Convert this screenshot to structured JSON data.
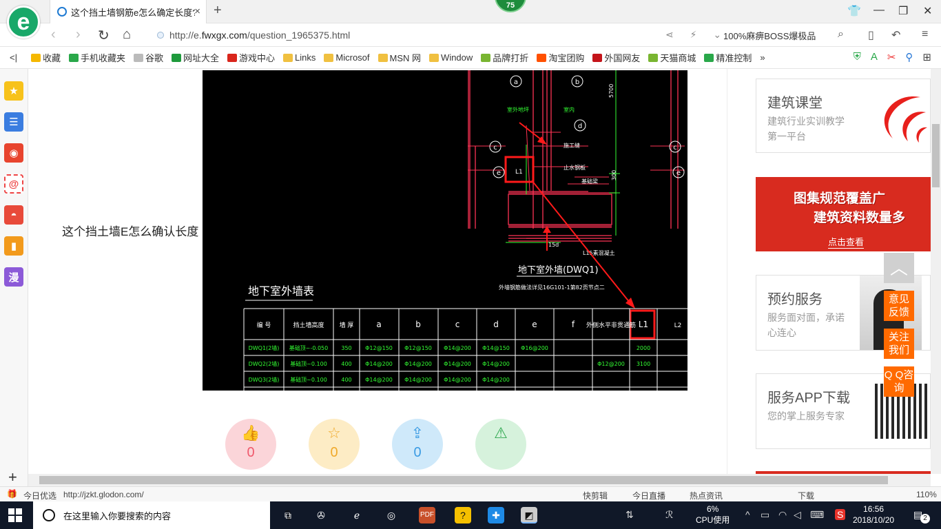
{
  "browser": {
    "tab_title": "这个挡土墙钢筋e怎么确定长度?",
    "tab_close": "×",
    "new_tab": "+",
    "badge_count": "75",
    "url_prefix": "http://e.",
    "url_domain": "fwxgx.com",
    "url_path": "/question_1965375.html",
    "search_label": "100%麻痹BOSS爆极品",
    "bookmarks": [
      {
        "label": "收藏",
        "color": "#f5b800"
      },
      {
        "label": "手机收藏夹",
        "color": "#2aa84a"
      },
      {
        "label": "谷歌",
        "color": "#bbbbbb"
      },
      {
        "label": "网址大全",
        "color": "#1e9a3c"
      },
      {
        "label": "游戏中心",
        "color": "#d9261c"
      },
      {
        "label": "Links",
        "color": "#f0c040"
      },
      {
        "label": "Microsof",
        "color": "#f0c040"
      },
      {
        "label": "MSN 网",
        "color": "#f0c040"
      },
      {
        "label": "Window",
        "color": "#f0c040"
      },
      {
        "label": "品牌打折",
        "color": "#79b531"
      },
      {
        "label": "淘宝团购",
        "color": "#ff5000"
      },
      {
        "label": "外国网友",
        "color": "#c4141a"
      },
      {
        "label": "天猫商城",
        "color": "#79b531"
      },
      {
        "label": "精准控制",
        "color": "#2aa84a"
      }
    ],
    "bookmarks_more": "»"
  },
  "page": {
    "question": "这个挡土墙E怎么确认长度",
    "actions": [
      {
        "name": "like",
        "glyph": "👍",
        "count": "0",
        "bg": "#fbd5d9",
        "fg": "#f0596c"
      },
      {
        "name": "favorite",
        "glyph": "☆",
        "count": "0",
        "bg": "#fdecc5",
        "fg": "#f0a92a"
      },
      {
        "name": "share",
        "glyph": "⇪",
        "count": "0",
        "bg": "#cfe9fa",
        "fg": "#3a9be3"
      },
      {
        "name": "report",
        "glyph": "⚠",
        "count": "",
        "bg": "#d6f2dc",
        "fg": "#2fa84f"
      }
    ]
  },
  "cad": {
    "labels": {
      "a": "a",
      "b": "b",
      "c": "c",
      "d": "d",
      "e": "e",
      "f": "f",
      "outside": "室外地坪",
      "inside": "室内",
      "dim_top": "5700",
      "dim_mid": "300",
      "dim_15d": "15d",
      "note1": "施工缝",
      "note2": "止水钢板",
      "note3": "基础梁",
      "note4": "L15素混凝土",
      "L1_marker": "L1",
      "title_drawing": "地下室外墙(DWQ1)",
      "title_table": "地下室外墙表",
      "subnote": "外墙钢筋做法详见16G101-1第82页节点二"
    },
    "table": {
      "headers": [
        "编 号",
        "挡土墙高度",
        "墙 厚",
        "a",
        "b",
        "c",
        "d",
        "e",
        "f",
        "外侧水平非贯通筋",
        "L1",
        "L2"
      ],
      "rows": [
        [
          "DWQ1(2墙)",
          "基础顶~-0.050",
          "350",
          "Φ12@150",
          "Φ12@150",
          "Φ14@200",
          "Φ14@150",
          "Φ16@200",
          "",
          "",
          "2000",
          ""
        ],
        [
          "DWQ2(2墙)",
          "基础顶~0.100",
          "400",
          "Φ14@200",
          "Φ14@200",
          "Φ14@200",
          "Φ14@200",
          "",
          "",
          "Φ12@200",
          "3100",
          ""
        ],
        [
          "DWQ3(2墙)",
          "基础顶~0.100",
          "400",
          "Φ14@200",
          "Φ14@200",
          "Φ14@200",
          "Φ14@200",
          "",
          "",
          "",
          "",
          ""
        ]
      ]
    },
    "colors": {
      "line": "#ff3355",
      "green": "#33ff33",
      "white": "#ffffff",
      "highlight": "#ff1a1a"
    }
  },
  "right": {
    "course_title": "建筑课堂",
    "course_sub": "建筑行业实训教学第一平台",
    "banner_line1": "图集规范覆盖广",
    "banner_line2": "建筑资料数量多",
    "banner_cta": "点击查看",
    "service_title": "预约服务",
    "service_sub": "服务面对面，承诺心连心",
    "app_title": "服务APP下载",
    "app_sub": "您的掌上服务专家",
    "floaters": [
      "意见反馈",
      "关注我们",
      "Q Q咨询"
    ],
    "totop": "︿"
  },
  "status": {
    "left": "今日优选",
    "url": "http://jzkt.glodon.com/",
    "items": [
      "快剪辑",
      "今日直播",
      "热点资讯",
      "下载"
    ],
    "zoom": "110%"
  },
  "taskbar": {
    "search_placeholder": "在这里输入你要搜索的内容",
    "cpu_value": "6%",
    "cpu_label": "CPU使用",
    "time": "16:56",
    "date": "2018/10/20",
    "notif": "2",
    "ime": "英"
  }
}
